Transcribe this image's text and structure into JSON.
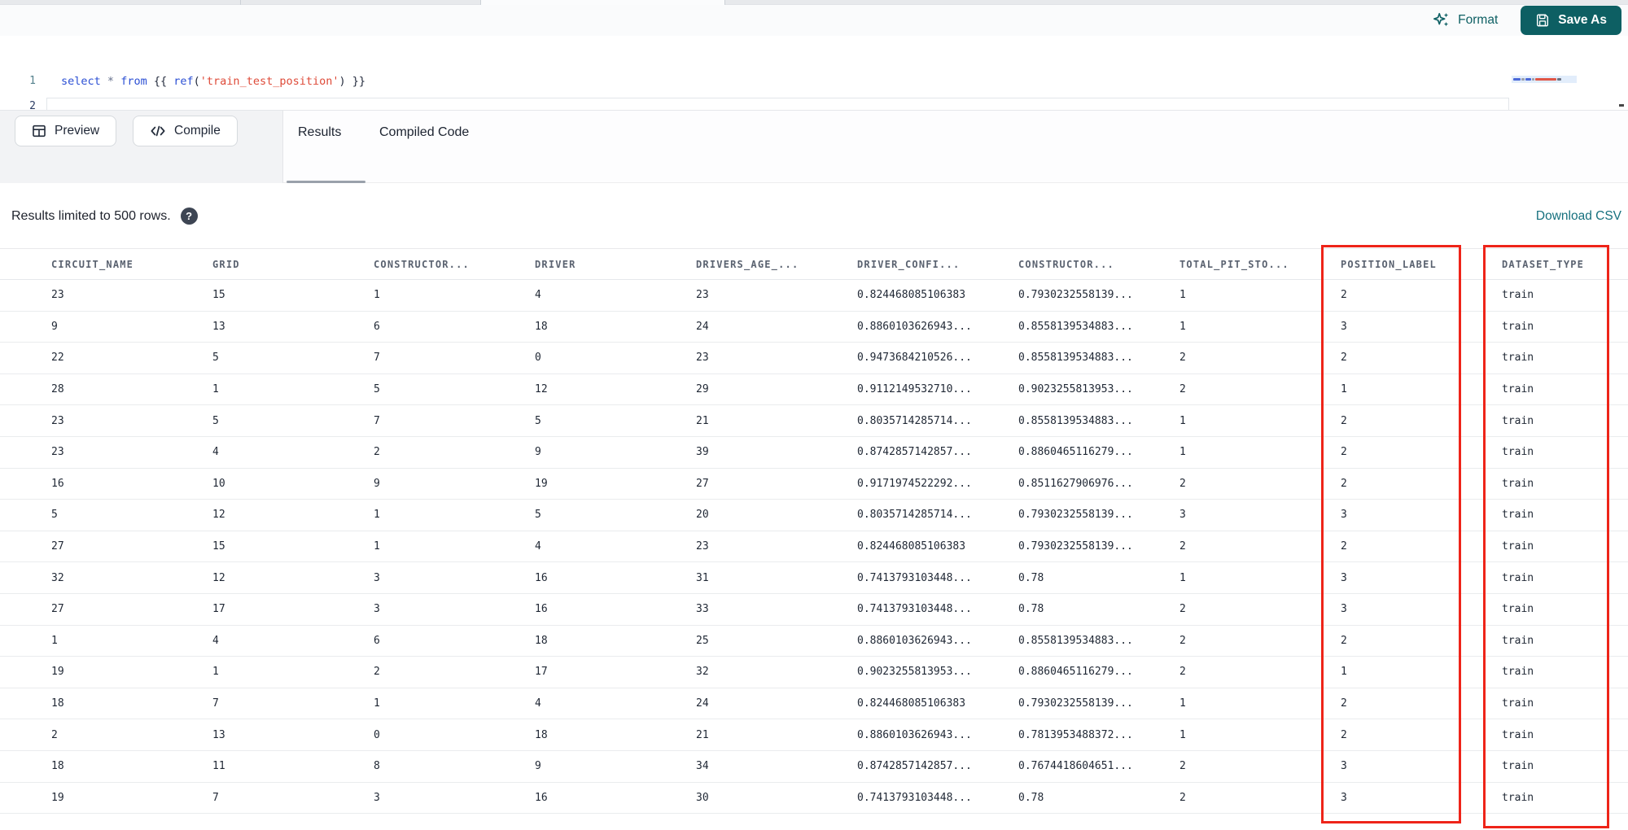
{
  "toolbar": {
    "format_label": "Format",
    "save_as_label": "Save As"
  },
  "editor": {
    "gutter": [
      "1",
      "2"
    ],
    "code_line": "select * from {{ ref('train_test_position') }}",
    "tokens": [
      {
        "t": "select",
        "c": "kw"
      },
      {
        "t": " ",
        "c": "pl"
      },
      {
        "t": "*",
        "c": "op"
      },
      {
        "t": " ",
        "c": "pl"
      },
      {
        "t": "from",
        "c": "kw"
      },
      {
        "t": " ",
        "c": "pl"
      },
      {
        "t": "{{",
        "c": "br"
      },
      {
        "t": " ",
        "c": "pl"
      },
      {
        "t": "ref",
        "c": "fn"
      },
      {
        "t": "(",
        "c": "br"
      },
      {
        "t": "'train_test_position'",
        "c": "str"
      },
      {
        "t": ")",
        "c": "br"
      },
      {
        "t": " ",
        "c": "pl"
      },
      {
        "t": "}}",
        "c": "br"
      }
    ]
  },
  "action_bar": {
    "preview_label": "Preview",
    "compile_label": "Compile",
    "tabs": [
      {
        "label": "Results",
        "active": true
      },
      {
        "label": "Compiled Code",
        "active": false
      }
    ]
  },
  "results_bar": {
    "limit_text": "Results limited to 500 rows.",
    "help_icon": "question-mark-circle",
    "download_link": "Download CSV"
  },
  "table": {
    "columns": [
      "CIRCUIT_NAME",
      "GRID",
      "CONSTRUCTOR...",
      "DRIVER",
      "DRIVERS_AGE_...",
      "DRIVER_CONFI...",
      "CONSTRUCTOR...",
      "TOTAL_PIT_STO...",
      "POSITION_LABEL",
      "DATASET_TYPE"
    ],
    "rows": [
      [
        "23",
        "15",
        "1",
        "4",
        "23",
        "0.824468085106383",
        "0.7930232558139...",
        "1",
        "2",
        "train"
      ],
      [
        "9",
        "13",
        "6",
        "18",
        "24",
        "0.8860103626943...",
        "0.8558139534883...",
        "1",
        "3",
        "train"
      ],
      [
        "22",
        "5",
        "7",
        "0",
        "23",
        "0.9473684210526...",
        "0.8558139534883...",
        "2",
        "2",
        "train"
      ],
      [
        "28",
        "1",
        "5",
        "12",
        "29",
        "0.9112149532710...",
        "0.9023255813953...",
        "2",
        "1",
        "train"
      ],
      [
        "23",
        "5",
        "7",
        "5",
        "21",
        "0.8035714285714...",
        "0.8558139534883...",
        "1",
        "2",
        "train"
      ],
      [
        "23",
        "4",
        "2",
        "9",
        "39",
        "0.8742857142857...",
        "0.8860465116279...",
        "1",
        "2",
        "train"
      ],
      [
        "16",
        "10",
        "9",
        "19",
        "27",
        "0.9171974522292...",
        "0.8511627906976...",
        "2",
        "2",
        "train"
      ],
      [
        "5",
        "12",
        "1",
        "5",
        "20",
        "0.8035714285714...",
        "0.7930232558139...",
        "3",
        "3",
        "train"
      ],
      [
        "27",
        "15",
        "1",
        "4",
        "23",
        "0.824468085106383",
        "0.7930232558139...",
        "2",
        "2",
        "train"
      ],
      [
        "32",
        "12",
        "3",
        "16",
        "31",
        "0.7413793103448...",
        "0.78",
        "1",
        "3",
        "train"
      ],
      [
        "27",
        "17",
        "3",
        "16",
        "33",
        "0.7413793103448...",
        "0.78",
        "2",
        "3",
        "train"
      ],
      [
        "1",
        "4",
        "6",
        "18",
        "25",
        "0.8860103626943...",
        "0.8558139534883...",
        "2",
        "2",
        "train"
      ],
      [
        "19",
        "1",
        "2",
        "17",
        "32",
        "0.9023255813953...",
        "0.8860465116279...",
        "2",
        "1",
        "train"
      ],
      [
        "18",
        "7",
        "1",
        "4",
        "24",
        "0.824468085106383",
        "0.7930232558139...",
        "1",
        "2",
        "train"
      ],
      [
        "2",
        "13",
        "0",
        "18",
        "21",
        "0.8860103626943...",
        "0.7813953488372...",
        "1",
        "2",
        "train"
      ],
      [
        "18",
        "11",
        "8",
        "9",
        "34",
        "0.8742857142857...",
        "0.7674418604651...",
        "2",
        "3",
        "train"
      ],
      [
        "19",
        "7",
        "3",
        "16",
        "30",
        "0.7413793103448...",
        "0.78",
        "2",
        "3",
        "train"
      ]
    ],
    "highlighted_columns": [
      "POSITION_LABEL",
      "DATASET_TYPE"
    ]
  },
  "colors": {
    "teal": "#0d5f63",
    "link_teal": "#16707e",
    "annotation_red": "#ee2419"
  }
}
